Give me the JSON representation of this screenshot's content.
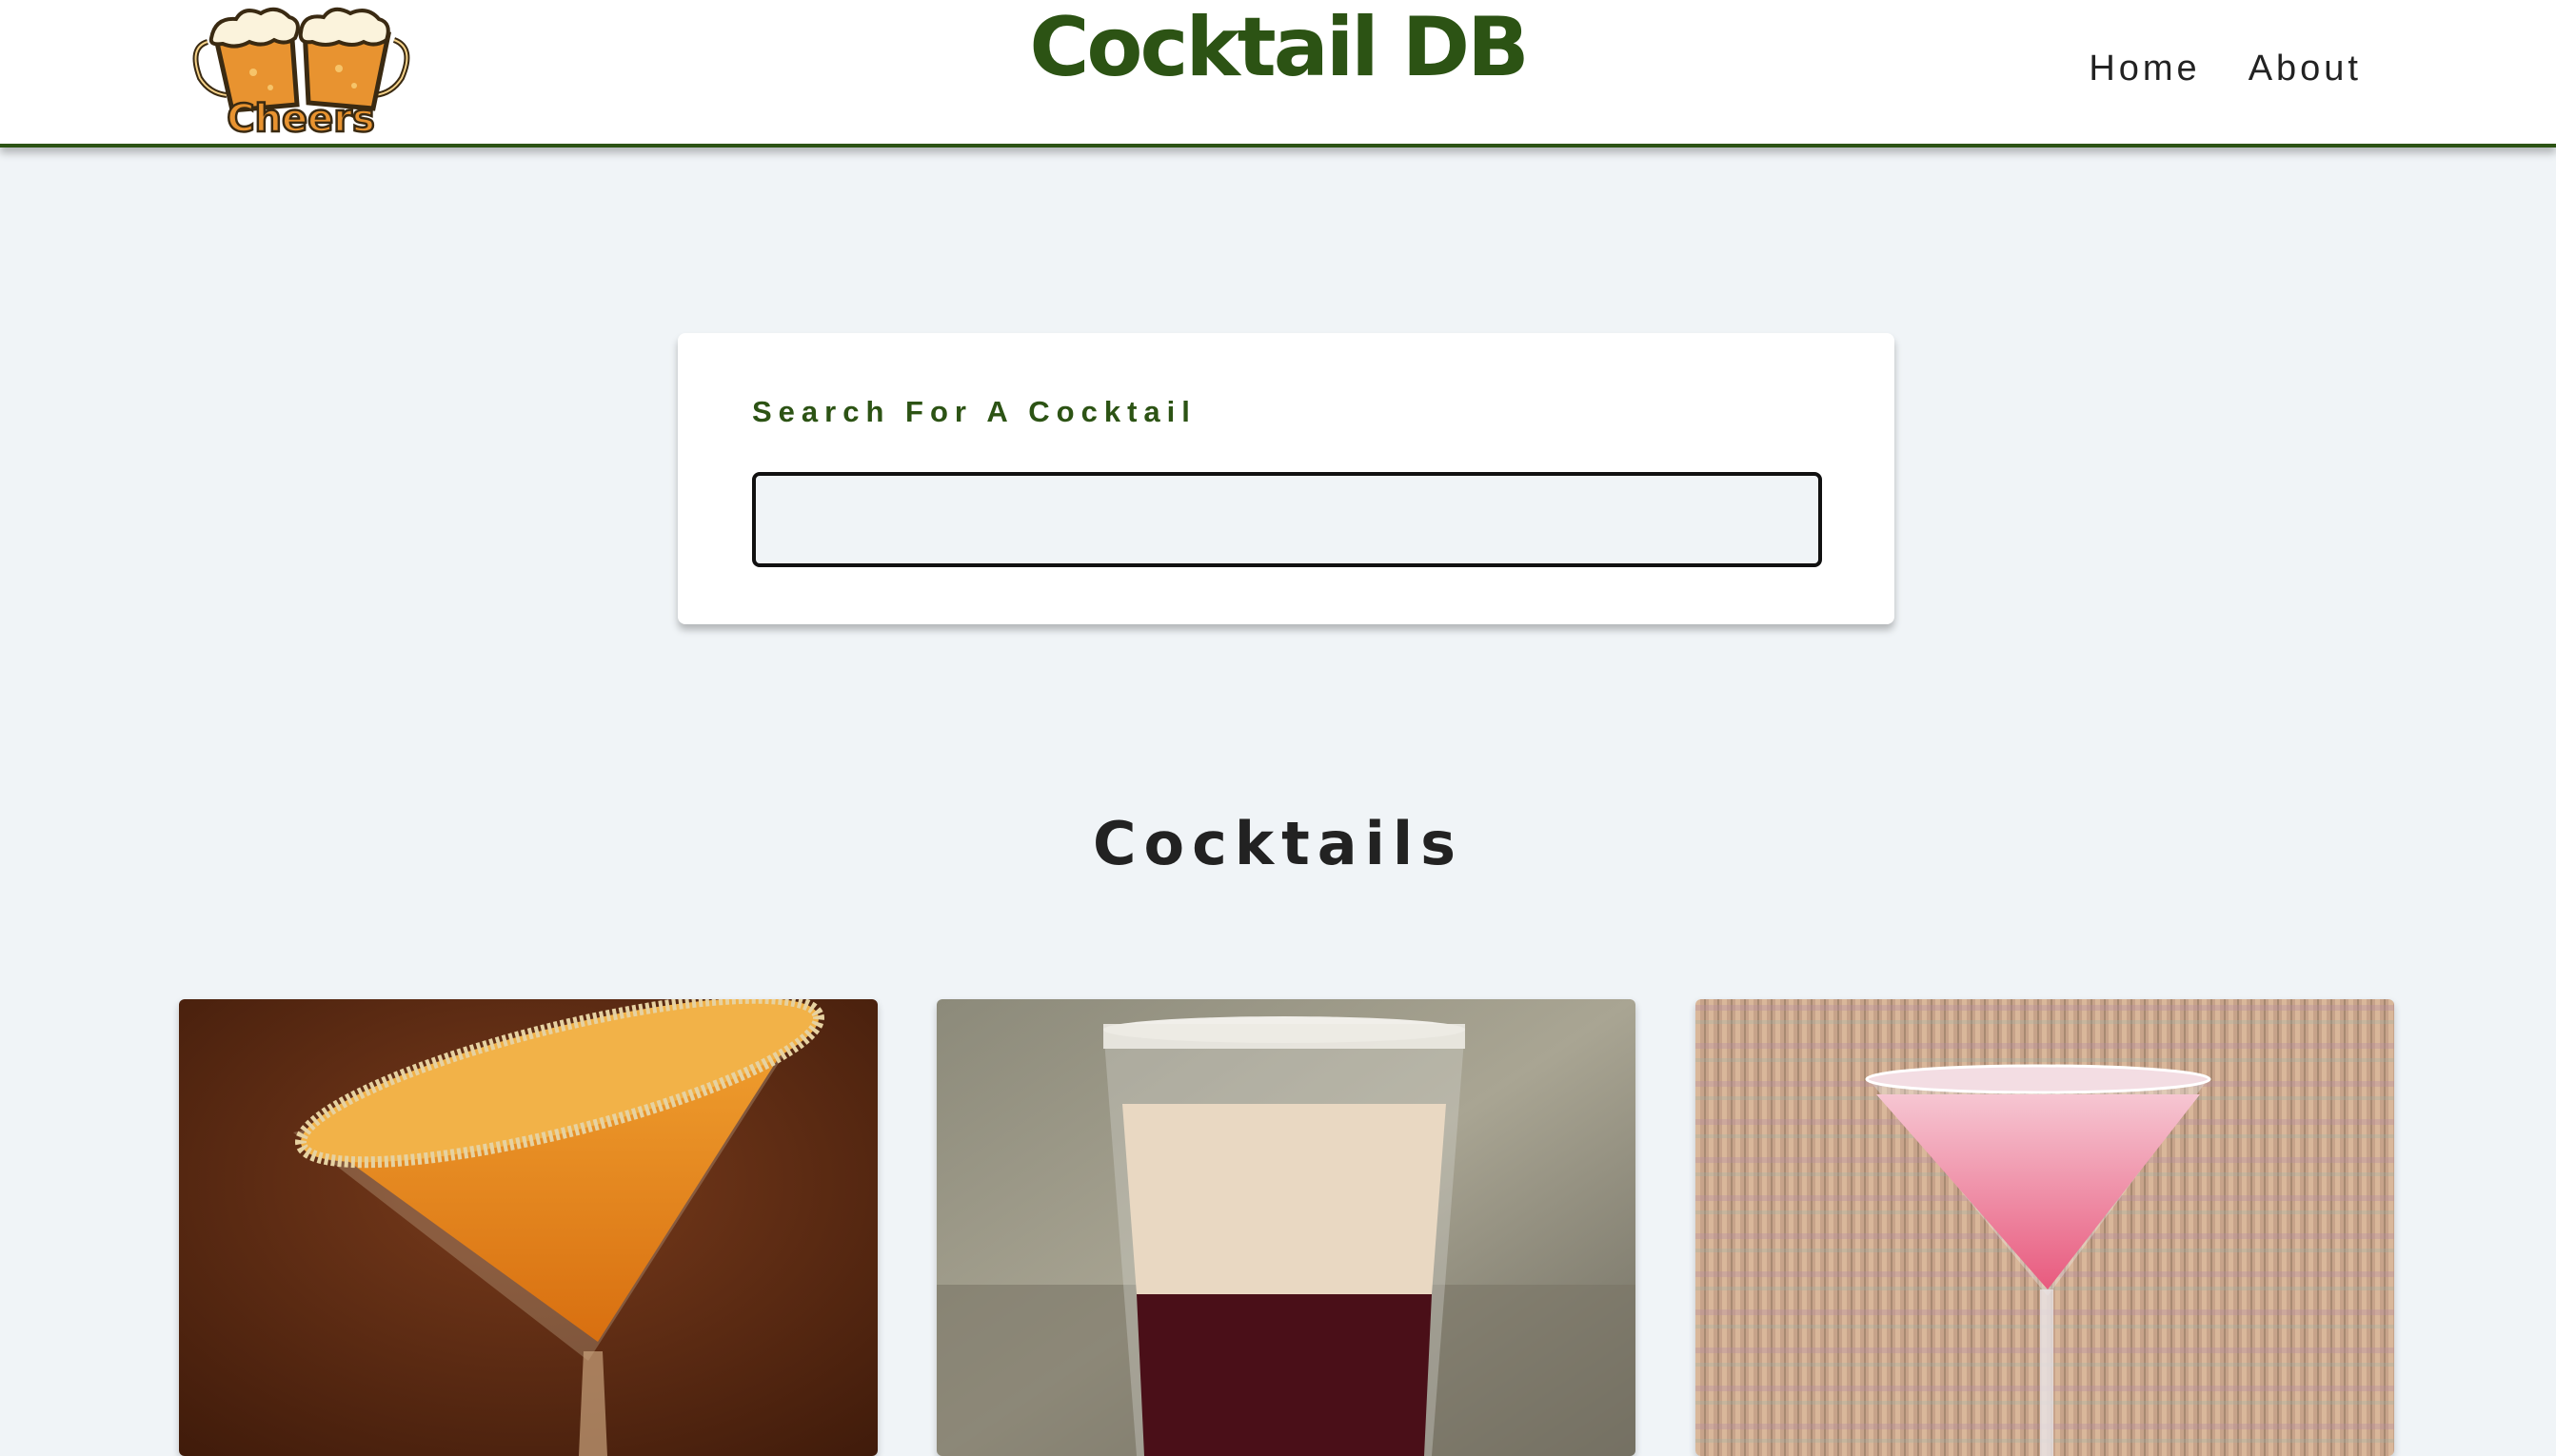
{
  "header": {
    "logo_text": "Cheers",
    "site_title": "Cocktail DB",
    "nav": [
      {
        "label": "Home"
      },
      {
        "label": "About"
      }
    ]
  },
  "search": {
    "label": "Search For A Cocktail",
    "value": "",
    "placeholder": ""
  },
  "cocktails": {
    "title": "Cocktails",
    "cards": [
      {
        "image": "orange-martini-sugar-rim"
      },
      {
        "image": "cream-over-red-layered-shot"
      },
      {
        "image": "pink-martini-striped-background"
      }
    ]
  },
  "colors": {
    "brand_green": "#2c5314",
    "page_background": "#f0f4f7",
    "logo_orange": "#e89330"
  }
}
